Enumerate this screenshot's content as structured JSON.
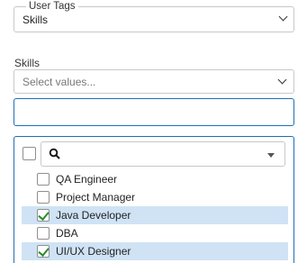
{
  "user_tags": {
    "legend": "User Tags",
    "value": "Skills"
  },
  "skills": {
    "label": "Skills",
    "placeholder": "Select values..."
  },
  "dropdown": {
    "options": [
      {
        "label": "QA Engineer",
        "checked": false
      },
      {
        "label": "Project Manager",
        "checked": false
      },
      {
        "label": "Java Developer",
        "checked": true
      },
      {
        "label": "DBA",
        "checked": false
      },
      {
        "label": "UI/UX Designer",
        "checked": true
      }
    ]
  },
  "colors": {
    "accent": "#1e6fb5",
    "selected_bg": "#cfe3f5",
    "check": "#2e8a2e"
  }
}
